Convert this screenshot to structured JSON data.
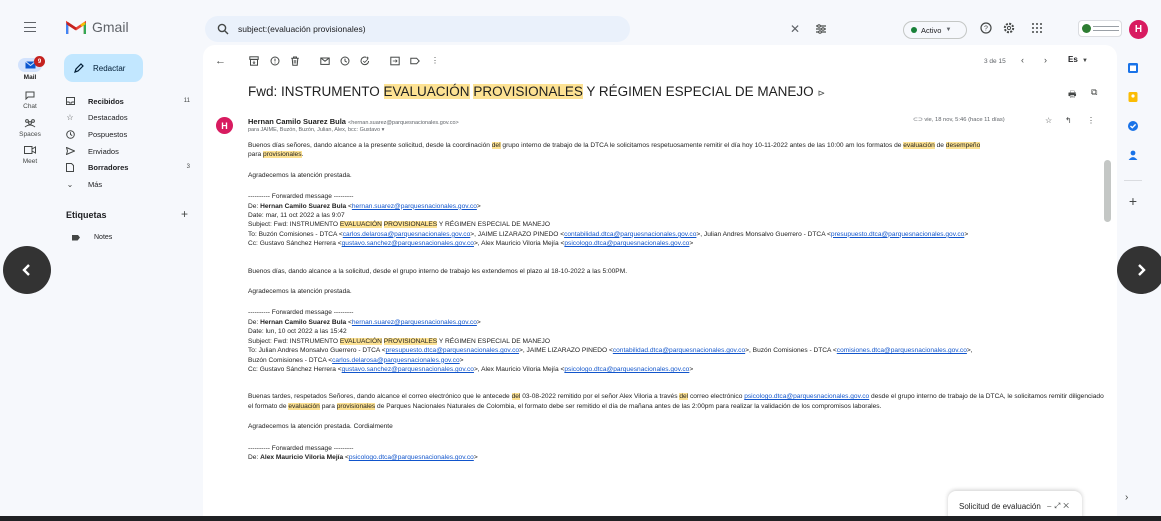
{
  "app": {
    "name": "Gmail"
  },
  "search": {
    "query": "subject:(evaluación provisionales)"
  },
  "status": {
    "label": "Activo"
  },
  "user": {
    "avatar_letter": "H"
  },
  "rail": {
    "mail": {
      "label": "Mail",
      "badge": "9"
    },
    "chat": {
      "label": "Chat"
    },
    "spaces": {
      "label": "Spaces"
    },
    "meet": {
      "label": "Meet"
    }
  },
  "compose": {
    "label": "Redactar"
  },
  "folders": [
    {
      "label": "Recibidos",
      "count": "11",
      "bold": true
    },
    {
      "label": "Destacados",
      "count": ""
    },
    {
      "label": "Pospuestos",
      "count": ""
    },
    {
      "label": "Enviados",
      "count": ""
    },
    {
      "label": "Borradores",
      "count": "3",
      "bold": true
    },
    {
      "label": "Más",
      "count": ""
    }
  ],
  "labels": {
    "title": "Etiquetas",
    "items": [
      "Notes"
    ]
  },
  "pager": {
    "text": "3 de 15",
    "lang": "Es"
  },
  "message": {
    "subject_prefix": "Fwd: INSTRUMENTO ",
    "subject_hl1": "EVALUACIÓN",
    "subject_hl2": "PROVISIONALES",
    "subject_suffix": " Y RÉGIMEN ESPECIAL DE MANEJO",
    "sender_name": "Hernan Camilo Suarez Bula",
    "sender_email": "<hernan.suarez@parquesnacionales.gov.co>",
    "recipients": "para JAIME, Buzón, Buzón, Julian, Alex, bcc: Gustavo",
    "date": "vie, 18 nov, 5:46 (hace 11 días)",
    "p1_a": "Buenos días señores, dando alcance a la presente solicitud, desde la coordinación ",
    "p1_hl_del": "del",
    "p1_b": " grupo interno de trabajo de la DTCA le solicitamos respetuosamente remitir el día hoy 10-11-2022 antes de las 10:00 am los formatos de ",
    "p1_hl_eval": "evaluación",
    "p1_c": " de ",
    "p1_hl_desemp": "desempeño",
    "p1_d": " para ",
    "p1_hl_prov": "provisionales",
    "p1_e": ".",
    "thanks1": "Agradecemos la atención prestada.",
    "fw_marker": "---------- Forwarded message ---------",
    "fw1_from_label": "De: ",
    "fw1_from_name": "Hernan Camilo Suarez Bula",
    "fw1_from_email": "hernan.suarez@parquesnacionales.gov.co",
    "fw1_date": "Date: mar, 11 oct 2022 a las 9:07",
    "fw_subject_prefix": "Subject: Fwd: INSTRUMENTO ",
    "fw_subject_hl1": "EVALUACIÓN",
    "fw_subject_hl2": "PROVISIONALES",
    "fw_subject_suffix": " Y RÉGIMEN ESPECIAL DE MANEJO",
    "fw1_to_a": "To: Buzón Comisiones - DTCA <",
    "fw1_to_link1": "carlos.delarosa@parquesnacionales.gov.co",
    "fw1_to_b": ">, JAIME LIZARAZO PINEDO <",
    "fw1_to_link2": "contabilidad.dtca@parquesnacionales.gov.co",
    "fw1_to_c": ">, Julian Andres Monsalvo Guerrero - DTCA <",
    "fw1_to_link3": "presupuesto.dtca@parquesnacionales.gov.co",
    "fw1_to_d": ">",
    "fw1_cc_a": "Cc: Gustavo Sánchez Herrera <",
    "fw1_cc_link1": "gustavo.sanchez@parquesnacionales.gov.co",
    "fw1_cc_b": ">, Alex Mauricio Viloria Mejía <",
    "fw1_cc_link2": "psicologo.dtca@parquesnacionales.gov.co",
    "fw1_cc_c": ">",
    "p2": "Buenos días, dando alcance a la solicitud, desde el grupo interno de trabajo les extendemos el plazo al 18-10-2022 a las 5:00PM.",
    "thanks2": "Agradecemos la atención prestada.",
    "fw2_from_name": "Hernan Camilo Suarez Bula",
    "fw2_from_email": "hernan.suarez@parquesnacionales.gov.co",
    "fw2_date": "Date: lun, 10 oct 2022 a las 15:42",
    "fw2_to_a": "To: Julian Andres Monsalvo Guerrero - DTCA <",
    "fw2_to_link1": "presupuesto.dtca@parquesnacionales.gov.co",
    "fw2_to_b": ">, JAIME LIZARAZO PINEDO <",
    "fw2_to_link2": "contabilidad.dtca@parquesnacionales.gov.co",
    "fw2_to_c": ">, Buzón Comisiones - DTCA <",
    "fw2_to_link3": "comisiones.dtca@parquesnacionales.gov.co",
    "fw2_to_d": ">,",
    "fw2_to2_a": "Buzón Comisiones - DTCA <",
    "fw2_to2_link": "carlos.delarosa@parquesnacionales.gov.co",
    "fw2_to2_b": ">",
    "fw2_cc_a": "Cc: Gustavo Sánchez Herrera <",
    "fw2_cc_link1": "gustavo.sanchez@parquesnacionales.gov.co",
    "fw2_cc_b": ">, Alex Mauricio Viloria Mejía <",
    "fw2_cc_link2": "psicologo.dtca@parquesnacionales.gov.co",
    "fw2_cc_c": ">",
    "p3_a": "Buenas tardes, respetados Señores, dando alcance el correo electrónico que le antecede ",
    "p3_hl_del1": "del",
    "p3_b": " 03-08-2022 remitido por el señor Alex Viloria a través ",
    "p3_hl_del2": "del",
    "p3_c": " correo electrónico ",
    "p3_link": "psicologo.dtca@parquesnacionales.gov.co",
    "p3_d": " desde el grupo interno de trabajo de la DTCA, le solicitamos remitir diligenciado el formato de ",
    "p3_hl_eval": "evaluación",
    "p3_e": " para ",
    "p3_hl_prov": "provisionales",
    "p3_f": " de Parques Nacionales Naturales de Colombia, el formato debe ser remitido el día de mañana antes de las 2:00pm para realizar la validación de los compromisos laborales.",
    "thanks3": "Agradecemos la atención prestada. Cordialmente",
    "fw3_from_name": "Alex Mauricio Viloria Mejía",
    "fw3_from_email": "psicologo.dtca@parquesnacionales.gov.co"
  },
  "draft": {
    "title": "Solicitud de evaluación"
  },
  "colors": {
    "accent": "#c2e7ff",
    "highlight": "#fde293",
    "avatar": "#d81b60"
  }
}
